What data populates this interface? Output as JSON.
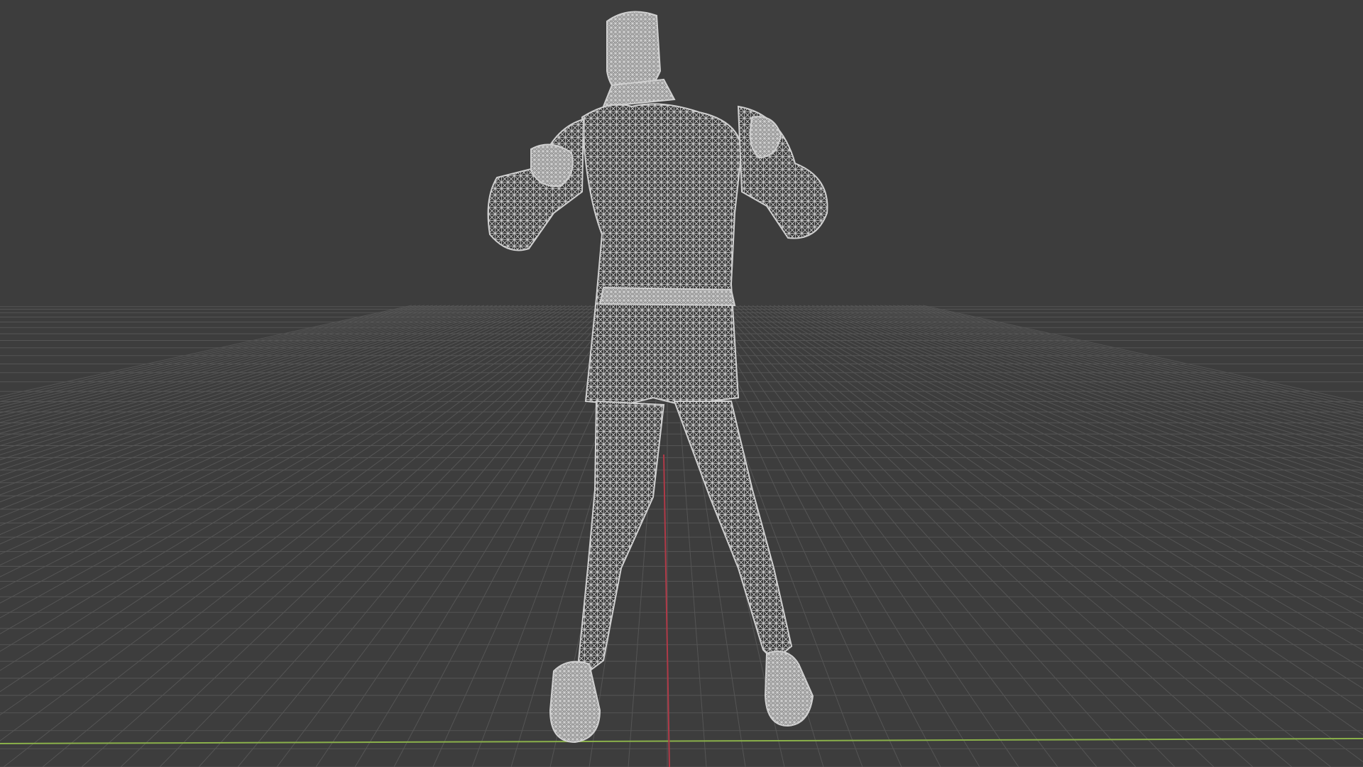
{
  "viewport": {
    "mode": "wireframe",
    "background_color": "#3d3d3d",
    "grid_color": "#555555",
    "mesh_color": "#c8c8c8",
    "x_axis_color": "#8ab04a",
    "y_axis_color": "#b03a48",
    "object": "humanoid-character-mesh"
  }
}
